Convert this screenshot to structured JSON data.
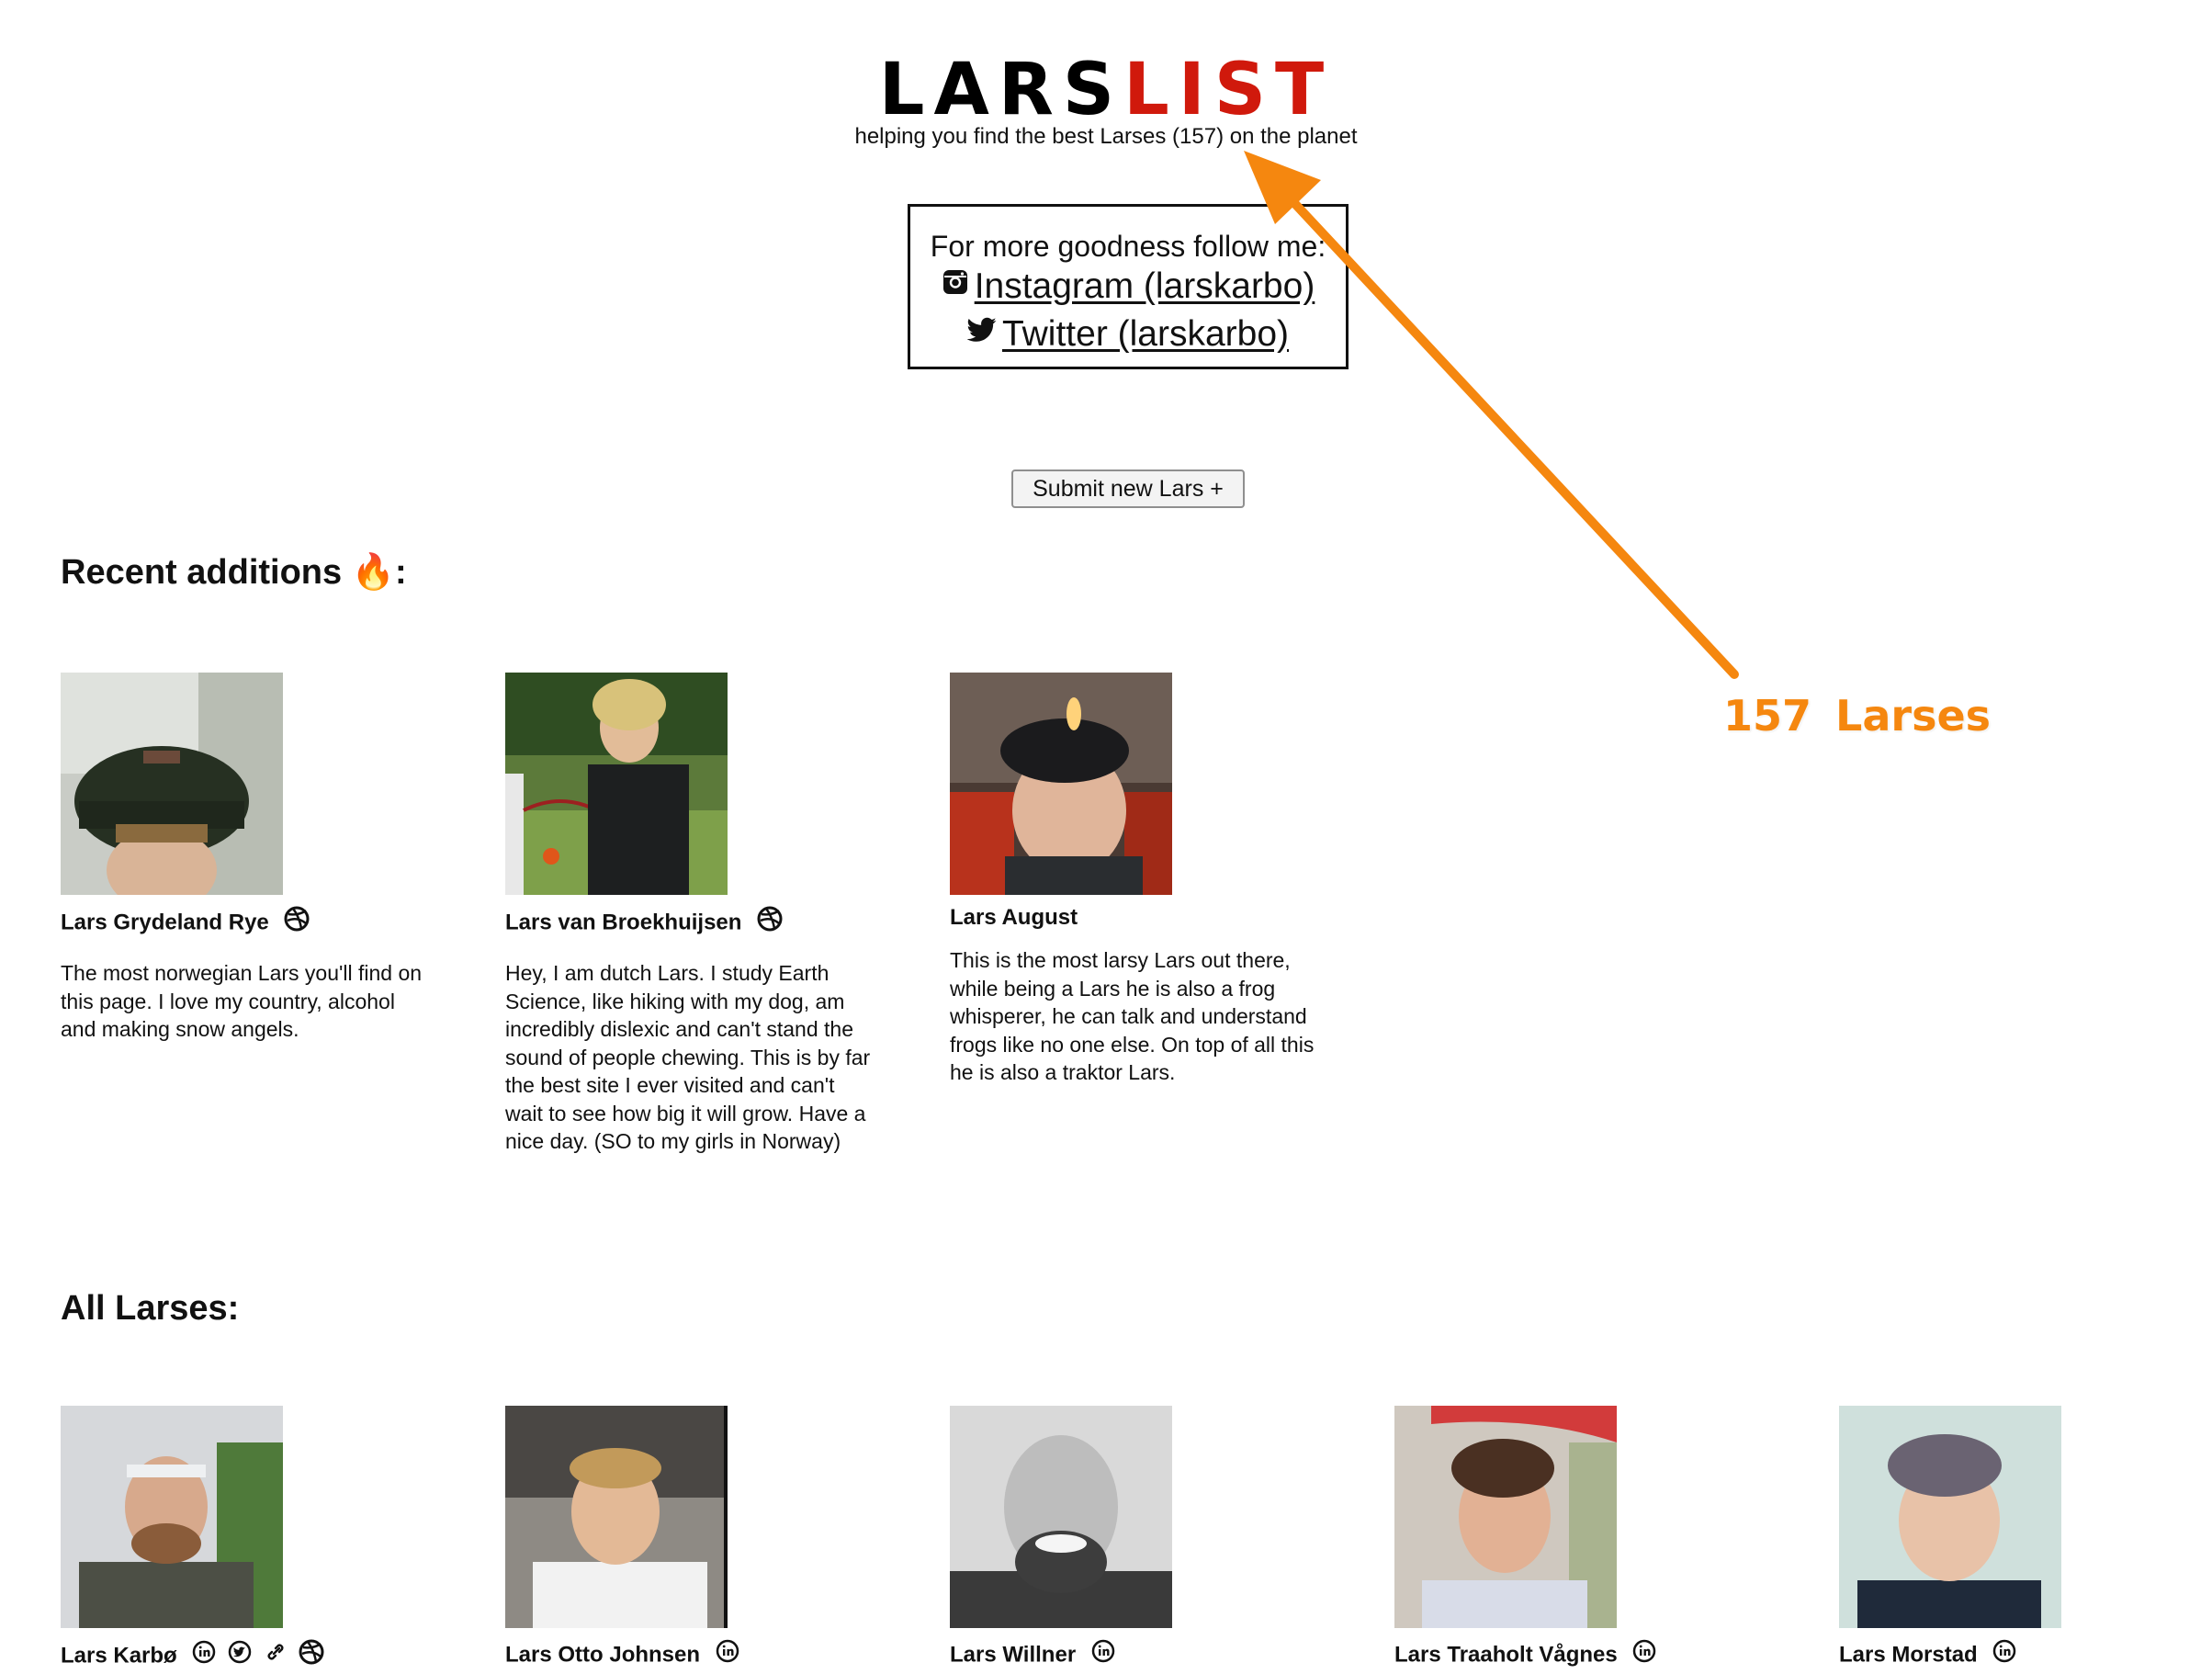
{
  "header": {
    "logo_part1": "LARS",
    "logo_part2": "LIST",
    "subtitle": "helping you find the best Larses (157) on the planet"
  },
  "follow": {
    "text": "For more goodness follow me:",
    "instagram_label": "Instagram (larskarbo)",
    "twitter_label": "Twitter (larskarbo)"
  },
  "submit_label": "Submit new Lars +",
  "recent": {
    "title": "Recent additions",
    "title_emoji": "🔥",
    "title_suffix": ":",
    "cards": [
      {
        "name": "Lars Grydeland Rye",
        "icons": [
          "dribbble-icon"
        ],
        "description": "The most norwegian Lars you'll find on this page. I love my country, alcohol and making snow angels."
      },
      {
        "name": "Lars van Broekhuijsen",
        "icons": [
          "dribbble-icon"
        ],
        "description": "Hey, I am dutch Lars. I study Earth Science, like hiking with my dog, am incredibly dislexic and can't stand the sound of people chewing. This is by far the best site I ever visited and can't wait to see how big it will grow. Have a nice day. (SO to my girls in Norway)"
      },
      {
        "name": "Lars August",
        "icons": [],
        "description": "This is the most larsy Lars out there, while being a Lars he is also a frog whisperer, he can talk and understand frogs like no one else. On top of all this he is also a traktor Lars."
      }
    ]
  },
  "all": {
    "title": "All Larses:",
    "cards": [
      {
        "name": "Lars Karbø",
        "icons": [
          "linkedin-icon",
          "twitter-icon",
          "link-icon",
          "dribbble-icon"
        ]
      },
      {
        "name": "Lars Otto Johnsen",
        "icons": [
          "linkedin-icon"
        ]
      },
      {
        "name": "Lars Willner",
        "icons": [
          "linkedin-icon"
        ]
      },
      {
        "name": "Lars Traaholt Vågnes",
        "icons": [
          "linkedin-icon"
        ]
      },
      {
        "name": "Lars Morstad",
        "icons": [
          "linkedin-icon"
        ]
      }
    ]
  },
  "annotation": {
    "label": "157 Larses",
    "color": "#f5870f"
  },
  "colors": {
    "logo_black": "#000000",
    "logo_red": "#d0190c",
    "text": "#111111"
  }
}
